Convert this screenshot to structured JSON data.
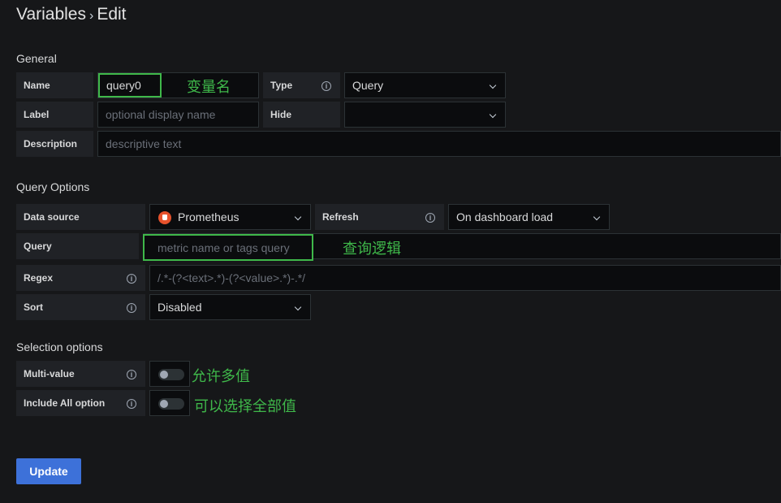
{
  "breadcrumb": {
    "parent": "Variables",
    "separator": "›",
    "current": "Edit"
  },
  "general": {
    "title": "General",
    "name_label": "Name",
    "name_value": "query0",
    "name_annotation": "变量名",
    "type_label": "Type",
    "type_value": "Query",
    "label_label": "Label",
    "label_placeholder": "optional display name",
    "hide_label": "Hide",
    "hide_value": "",
    "description_label": "Description",
    "description_placeholder": "descriptive text"
  },
  "query_options": {
    "title": "Query Options",
    "datasource_label": "Data source",
    "datasource_value": "Prometheus",
    "refresh_label": "Refresh",
    "refresh_value": "On dashboard load",
    "query_label": "Query",
    "query_placeholder": "metric name or tags query",
    "query_annotation": "查询逻辑",
    "regex_label": "Regex",
    "regex_placeholder": "/.*-(?<text>.*)-(?<value>.*)-.*/",
    "sort_label": "Sort",
    "sort_value": "Disabled"
  },
  "selection_options": {
    "title": "Selection options",
    "multi_value_label": "Multi-value",
    "multi_value_enabled": false,
    "multi_value_annotation": "允许多值",
    "include_all_label": "Include All option",
    "include_all_enabled": false,
    "include_all_annotation": "可以选择全部值"
  },
  "actions": {
    "update_label": "Update"
  },
  "colors": {
    "primary": "#3d71d9",
    "annotation": "#3fb84a",
    "background": "#161719"
  }
}
